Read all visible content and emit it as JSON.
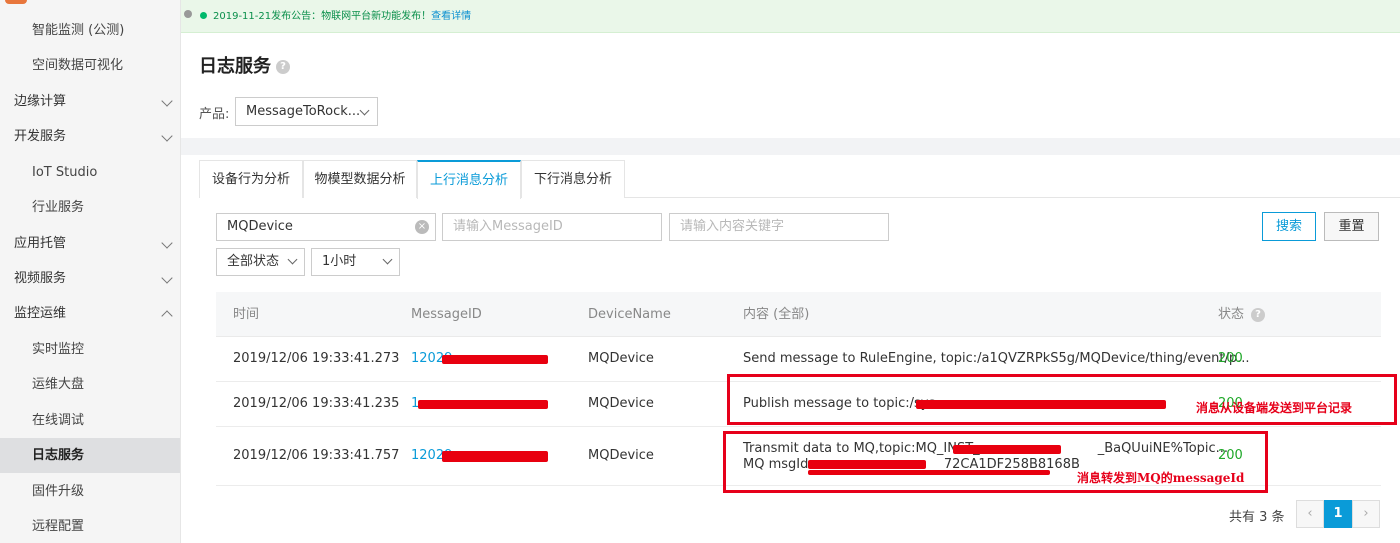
{
  "sidebar": {
    "items": [
      {
        "label": "智能监测 (公测)",
        "type": "sub"
      },
      {
        "label": "空间数据可视化",
        "type": "sub"
      },
      {
        "label": "边缘计算",
        "type": "group",
        "chevron": "down"
      },
      {
        "label": "开发服务",
        "type": "group",
        "chevron": "down"
      },
      {
        "label": "IoT Studio",
        "type": "sub"
      },
      {
        "label": "行业服务",
        "type": "sub"
      },
      {
        "label": "应用托管",
        "type": "group",
        "chevron": "down"
      },
      {
        "label": "视频服务",
        "type": "group",
        "chevron": "down"
      },
      {
        "label": "监控运维",
        "type": "group",
        "chevron": "up"
      },
      {
        "label": "实时监控",
        "type": "sub"
      },
      {
        "label": "运维大盘",
        "type": "sub"
      },
      {
        "label": "在线调试",
        "type": "sub"
      },
      {
        "label": "日志服务",
        "type": "sub",
        "active": true
      },
      {
        "label": "固件升级",
        "type": "sub"
      },
      {
        "label": "远程配置",
        "type": "sub"
      }
    ]
  },
  "notice": {
    "text": "2019-11-21发布公告：物联网平台新功能发布！",
    "link": "查看详情"
  },
  "header": {
    "title": "日志服务",
    "help_icon": "?",
    "product_label": "产品:",
    "product_value": "MessageToRock..."
  },
  "tabs": [
    {
      "label": "设备行为分析"
    },
    {
      "label": "物模型数据分析"
    },
    {
      "label": "上行消息分析",
      "active": true
    },
    {
      "label": "下行消息分析"
    }
  ],
  "filters": {
    "device_value": "MQDevice",
    "clear_icon": "×",
    "message_id_placeholder": "请输入MessageID",
    "content_placeholder": "请输入内容关键字",
    "status_value": "全部状态",
    "time_value": "1小时",
    "search_label": "搜索",
    "reset_label": "重置"
  },
  "table": {
    "headers": {
      "time": "时间",
      "message_id": "MessageID",
      "device_name": "DeviceName",
      "content": "内容 (全部)",
      "status": "状态"
    },
    "rows": [
      {
        "time": "2019/12/06 19:33:41.273",
        "message_id": "12029",
        "device_name": "MQDevice",
        "content_line1": "Send message to RuleEngine, topic:/a1QVZRPkS5g/MQDevice/thing/event/p...",
        "content_line2": "",
        "status": "200"
      },
      {
        "time": "2019/12/06 19:33:41.235",
        "message_id": "1",
        "device_name": "MQDevice",
        "content_line1": "Publish message to topic:/sys",
        "content_line2": "",
        "status": "200"
      },
      {
        "time": "2019/12/06 19:33:41.757",
        "message_id": "12029",
        "device_name": "MQDevice",
        "content_line1": "Transmit data to MQ,topic:MQ_INST_",
        "content_line1_tail": "_BaQUuiNE%Topic...",
        "content_line2": "MQ msgId: ",
        "content_line2_tail": "72CA1DF258B8168B",
        "status": "200"
      }
    ]
  },
  "annotations": {
    "upstream": "消息从设备端发送到平台记录",
    "mq": "消息转发到MQ的messageId"
  },
  "pagination": {
    "total": "共有 3 条",
    "prev": "‹",
    "current": "1",
    "next": "›"
  },
  "colors": {
    "accent": "#0a9bd8",
    "status_ok": "#1fa829",
    "annotation_red": "#e6001a",
    "notice_bg": "#eaf7e9"
  }
}
